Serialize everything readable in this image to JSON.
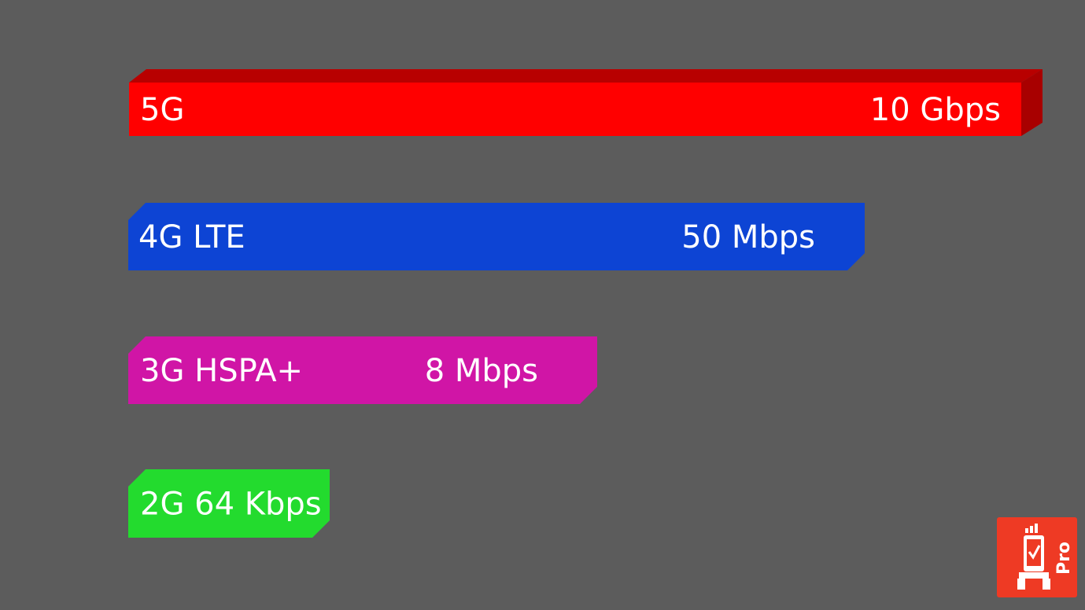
{
  "chart_data": {
    "type": "bar",
    "orientation": "horizontal",
    "bars": [
      {
        "label": "5G",
        "value_text": "10 Gbps",
        "color": "#ff0000",
        "color_dark": "#b80000"
      },
      {
        "label": "4G LTE",
        "value_text": "50 Mbps",
        "color": "#0d44d4"
      },
      {
        "label": "3G HSPA+",
        "value_text": "8 Mbps",
        "color": "#d015a6"
      },
      {
        "label": "2G 64 Kbps",
        "value_text": "",
        "color": "#23db2e"
      }
    ],
    "grid": false,
    "legend": "none"
  },
  "logo": {
    "icon": "speed-test-pro-icon",
    "text": "Pro",
    "color": "#ee3a24"
  },
  "background": "#5c5c5c"
}
